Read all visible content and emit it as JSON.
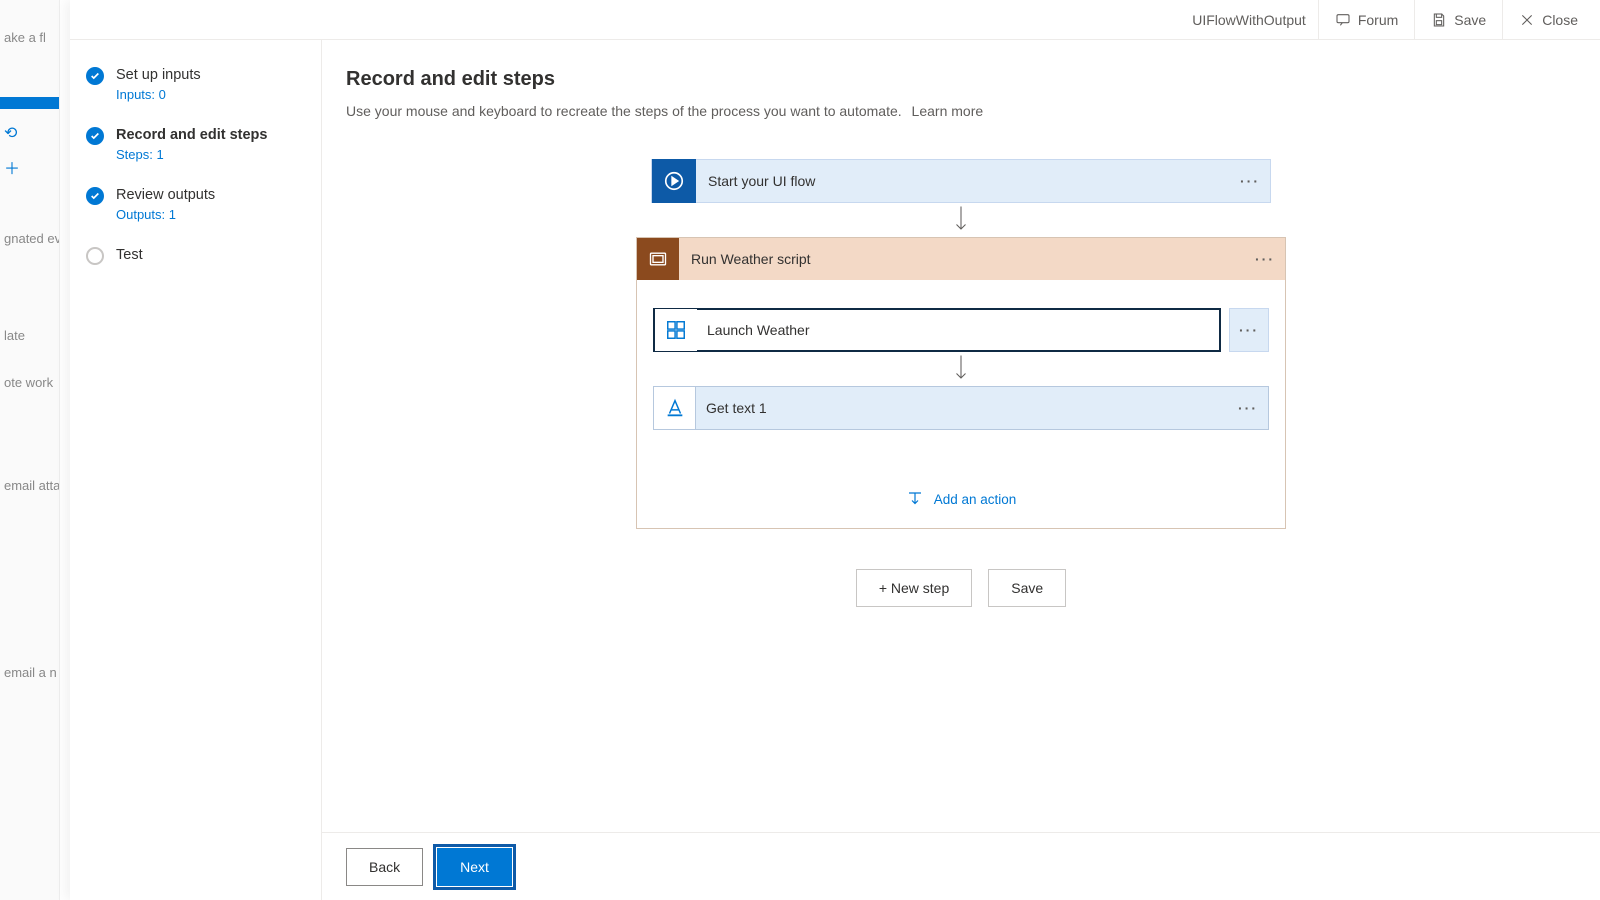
{
  "header": {
    "flow_name": "UIFlowWithOutput",
    "forum": "Forum",
    "save": "Save",
    "close": "Close"
  },
  "nav_steps": [
    {
      "label": "Set up inputs",
      "sub": "Inputs: 0",
      "done": true,
      "active": false
    },
    {
      "label": "Record and edit steps",
      "sub": "Steps: 1",
      "done": true,
      "active": true
    },
    {
      "label": "Review outputs",
      "sub": "Outputs: 1",
      "done": true,
      "active": false
    },
    {
      "label": "Test",
      "sub": "",
      "done": false,
      "active": false
    }
  ],
  "page": {
    "title": "Record and edit steps",
    "description": "Use your mouse and keyboard to recreate the steps of the process you want to automate.",
    "learn_more": "Learn more"
  },
  "flow": {
    "start_card": "Start your UI flow",
    "script_header": "Run Weather script",
    "sub_steps": [
      {
        "label": "Launch Weather",
        "selected": true,
        "icon": "window"
      },
      {
        "label": "Get text 1",
        "selected": false,
        "icon": "text"
      }
    ],
    "add_action": "Add an action"
  },
  "mid_buttons": {
    "new_step": "+ New step",
    "save": "Save"
  },
  "footer": {
    "back": "Back",
    "next": "Next"
  },
  "bg_fragments": {
    "a": "ake a fl",
    "b": "gnated even",
    "c": "late",
    "d": "ote work",
    "e": "email attac",
    "f": "email a n"
  }
}
